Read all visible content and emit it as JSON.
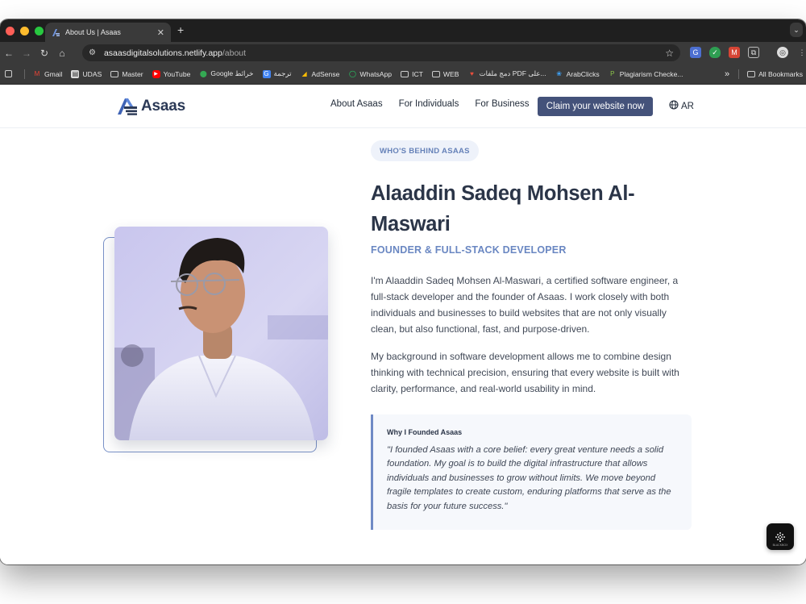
{
  "browser": {
    "tab_title": "About Us | Asaas",
    "new_tab": "+",
    "url_host": "asaasdigitalsolutions.netlify.app",
    "url_path": "/about",
    "bookmarks": [
      {
        "label": "Gmail",
        "icon": "gmail-icon",
        "color": "#ea4335"
      },
      {
        "label": "UDAS",
        "icon": "udas-icon",
        "color": "#e0e0e0"
      },
      {
        "label": "Master",
        "icon": "folder-icon",
        "color": "#e0e0e0"
      },
      {
        "label": "YouTube",
        "icon": "youtube-icon",
        "color": "#ff0000"
      },
      {
        "label": "Google خرائط",
        "icon": "maps-icon",
        "color": "#34a853"
      },
      {
        "label": "ترجمة",
        "icon": "translate-icon",
        "color": "#4285f4"
      },
      {
        "label": "AdSense",
        "icon": "adsense-icon",
        "color": "#fbbc04"
      },
      {
        "label": "WhatsApp",
        "icon": "whatsapp-icon",
        "color": "#25d366"
      },
      {
        "label": "ICT",
        "icon": "folder-icon",
        "color": "#e0e0e0"
      },
      {
        "label": "WEB",
        "icon": "folder-icon",
        "color": "#e0e0e0"
      },
      {
        "label": "دمج ملفات PDF على...",
        "icon": "pdf-icon",
        "color": "#e94e3c"
      },
      {
        "label": "ArabClicks",
        "icon": "arabclicks-icon",
        "color": "#3ea6ff"
      },
      {
        "label": "Plagiarism Checke...",
        "icon": "plagiarism-icon",
        "color": "#8bc34a"
      }
    ],
    "more": "»",
    "all_bookmarks": "All Bookmarks"
  },
  "site": {
    "logo_text": "Asaas",
    "nav": [
      "About Asaas",
      "For Individuals",
      "For Business"
    ],
    "cta": "Claim your website now",
    "lang": "AR"
  },
  "about": {
    "badge": "WHO'S BEHIND ASAAS",
    "name": "Alaaddin Sadeq Mohsen Al-Maswari",
    "role": "FOUNDER & FULL-STACK DEVELOPER",
    "p1": "I'm Alaaddin Sadeq Mohsen Al-Maswari, a certified software engineer, a full-stack developer and the founder of Asaas. I work closely with both individuals and businesses to build websites that are not only visually clean, but also functional, fast, and purpose-driven.",
    "p2": "My background in software development allows me to combine design thinking with technical precision, ensuring that every website is built with clarity, performance, and real-world usability in mind.",
    "quote_title": "Why I Founded Asaas",
    "quote_text": "\"I founded Asaas with a core belief: every great venture needs a solid foundation. My goal is to build the digital infrastructure that allows individuals and businesses to grow without limits. We move beyond fragile templates to create custom, enduring platforms that serve as the basis for your future success.\""
  },
  "widget": {
    "label": "BLACKBOX"
  },
  "colors": {
    "accent": "#44527a",
    "brand": "#2b3956",
    "highlight": "#6a87c2"
  }
}
